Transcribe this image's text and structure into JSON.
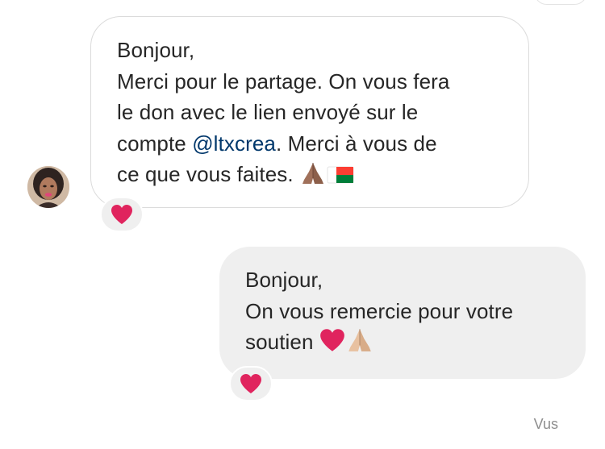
{
  "thread": {
    "incoming": {
      "lines": [
        "Bonjour,",
        "Merci pour le partage. On vous fera",
        "le don avec le lien envoyé sur le"
      ],
      "line4_before": "compte ",
      "mention": "@ltxcrea",
      "line4_after": ". Merci à vous de",
      "line5": "ce que vous faites. ",
      "emojis": [
        "praying-hands-icon",
        "madagascar-flag-icon"
      ],
      "reaction_icon": "red-heart-icon"
    },
    "outgoing": {
      "lines": [
        "Bonjour,",
        "On vous remercie pour votre"
      ],
      "line3": "soutien ",
      "emojis": [
        "red-heart-icon",
        "praying-hands-icon"
      ],
      "reaction_icon": "red-heart-icon"
    },
    "seen_label": "Vus"
  },
  "colors": {
    "mention": "#00376b",
    "heart": "#e0245e",
    "outgoing_bubble": "#efefef",
    "incoming_border": "#dbdbdb",
    "seen_text": "#8e8e8e",
    "flag_red": "#fc3d32",
    "flag_green": "#007e3a"
  }
}
